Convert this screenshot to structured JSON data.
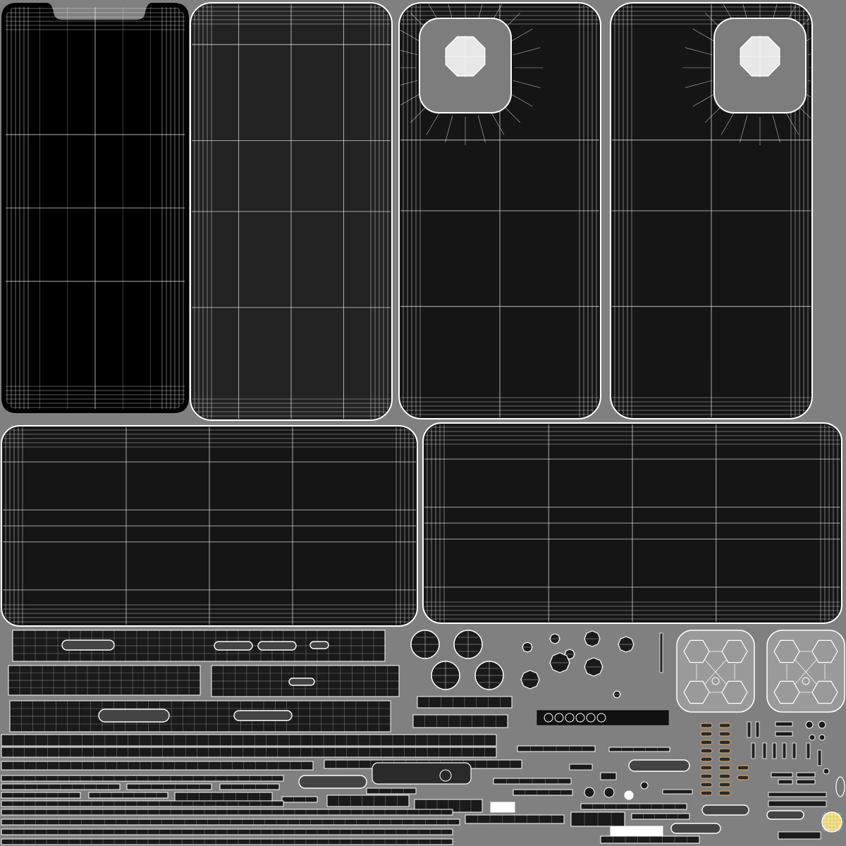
{
  "uv_layout": {
    "background_color": "#808080",
    "wire_color": "#ffffff",
    "fill_colors": {
      "screen": "#000000",
      "back_dark": "#222222",
      "panel": "#151515",
      "camera_plate": "#7d7d7d",
      "lens_fill": "#e8e8e8",
      "accent_orange": "#d2a060",
      "accent_yellow": "#e6d36a"
    },
    "islands": [
      {
        "name": "front-screen-island",
        "kind": "screen-with-notch"
      },
      {
        "name": "back-glass-island",
        "kind": "back-glass"
      },
      {
        "name": "back-panel-camera-island-left",
        "kind": "back-with-camera"
      },
      {
        "name": "back-panel-camera-island-right",
        "kind": "back-with-camera"
      },
      {
        "name": "side-frame-island-left",
        "kind": "side-frame"
      },
      {
        "name": "side-frame-island-right",
        "kind": "side-frame"
      },
      {
        "name": "camera-bump-island-left",
        "kind": "camera-bump"
      },
      {
        "name": "camera-bump-island-right",
        "kind": "camera-bump"
      },
      {
        "name": "small-parts-cluster",
        "kind": "strips-and-buttons"
      }
    ]
  }
}
